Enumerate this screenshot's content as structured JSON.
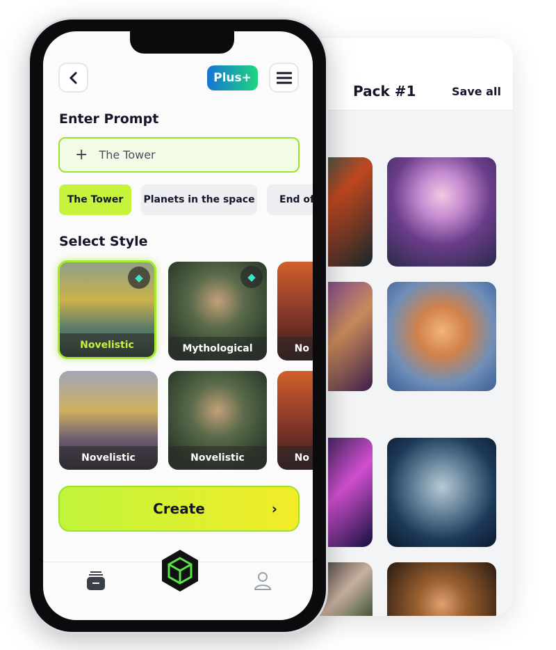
{
  "pack_screen": {
    "title": "Pack #1",
    "save_all": "Save all"
  },
  "header": {
    "plus_label": "Plus+",
    "back_icon": "chevron-left",
    "menu_icon": "hamburger"
  },
  "prompt": {
    "heading": "Enter Prompt",
    "value": "The Tower"
  },
  "chips": [
    {
      "label": "The Tower",
      "active": true
    },
    {
      "label": "Planets in the space",
      "active": false
    },
    {
      "label": "End of the",
      "active": false
    }
  ],
  "style": {
    "heading": "Select Style",
    "cards": [
      {
        "label": "Novelistic",
        "selected": true,
        "premium": true
      },
      {
        "label": "Mythological",
        "selected": false,
        "premium": true
      },
      {
        "label": "No",
        "selected": false,
        "premium": false
      },
      {
        "label": "Novelistic",
        "selected": false,
        "premium": false
      },
      {
        "label": "Novelistic",
        "selected": false,
        "premium": false
      },
      {
        "label": "No",
        "selected": false,
        "premium": false
      }
    ]
  },
  "create": {
    "label": "Create"
  },
  "colors": {
    "accent": "#c6f43a",
    "plus_start": "#1574d6",
    "plus_end": "#1fd67f"
  }
}
